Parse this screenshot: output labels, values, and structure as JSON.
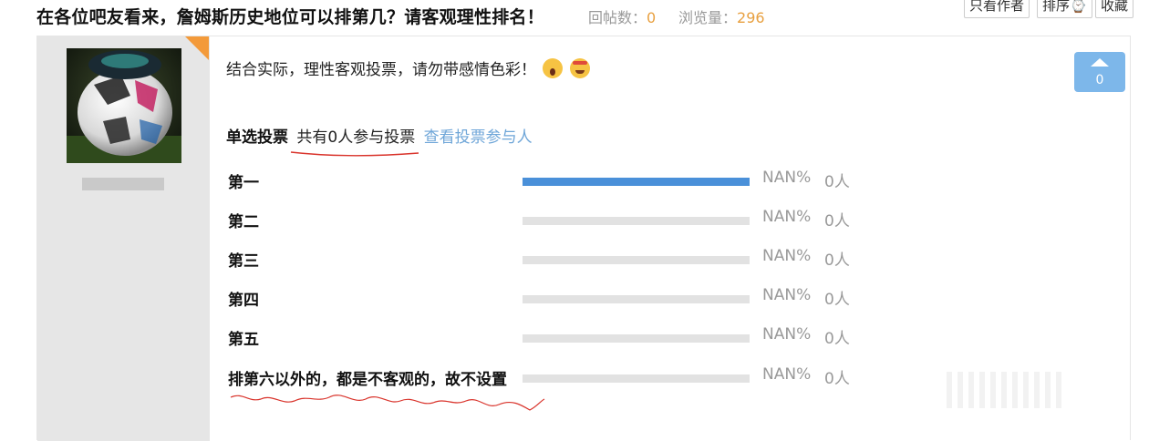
{
  "header": {
    "title": "在各位吧友看来，詹姆斯历史地位可以排第几？请客观理性排名！",
    "replies_label": "回帖数：",
    "replies_value": "0",
    "views_label": "浏览量：",
    "views_value": "296",
    "buttons": {
      "only_author": "只看作者",
      "sort": "排序",
      "favorite": "收藏"
    }
  },
  "post": {
    "body_text": "结合实际，理性客观投票，请勿带感情色彩！",
    "emojis": [
      "shocked-face-icon",
      "star-struck-face-icon"
    ],
    "upvote_count": "0",
    "poll": {
      "type": "单选投票",
      "total_text": "共有0人参与投票",
      "view_voters_link": "查看投票参与人",
      "options": [
        {
          "label": "第一",
          "percent_text": "NAN%",
          "count_text": "0人",
          "fill": 1.0
        },
        {
          "label": "第二",
          "percent_text": "NAN%",
          "count_text": "0人",
          "fill": 0
        },
        {
          "label": "第三",
          "percent_text": "NAN%",
          "count_text": "0人",
          "fill": 0
        },
        {
          "label": "第四",
          "percent_text": "NAN%",
          "count_text": "0人",
          "fill": 0
        },
        {
          "label": "第五",
          "percent_text": "NAN%",
          "count_text": "0人",
          "fill": 0
        },
        {
          "label": "排第六以外的，都是不客观的，故不设置",
          "percent_text": "NAN%",
          "count_text": "0人",
          "fill": 0
        }
      ]
    }
  },
  "colors": {
    "accent_orange": "#f39a3a",
    "bar_fill": "#4a90d9",
    "upvote_bg": "#7db7ea",
    "link": "#6fa6d8",
    "annotation_red": "#d9332b"
  }
}
